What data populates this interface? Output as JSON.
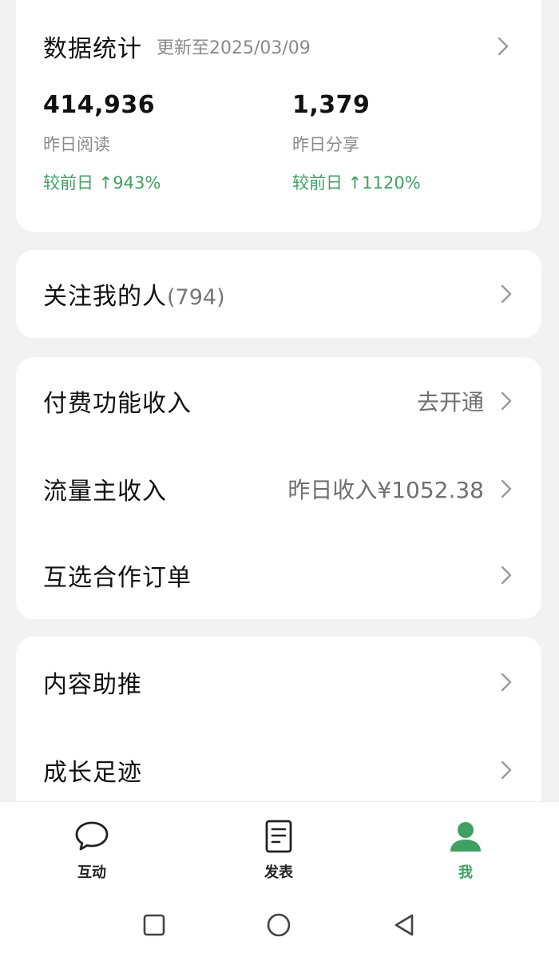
{
  "stats": {
    "title": "数据统计",
    "updated": "更新至2025/03/09",
    "reads": {
      "value": "414,936",
      "label": "昨日阅读",
      "change": "较前日 ↑943%"
    },
    "shares": {
      "value": "1,379",
      "label": "昨日分享",
      "change": "较前日 ↑1120%"
    }
  },
  "followers": {
    "label": "关注我的人",
    "count": "(794)"
  },
  "income": {
    "paid_features": {
      "label": "付费功能收入",
      "value": "去开通"
    },
    "traffic_owner": {
      "label": "流量主收入",
      "value": "昨日收入¥1052.38"
    },
    "mutual_orders": {
      "label": "互选合作订单"
    }
  },
  "tools": {
    "content_boost": {
      "label": "内容助推"
    },
    "growth_track": {
      "label": "成长足迹"
    }
  },
  "bottom_nav": {
    "items": [
      {
        "label": "互动",
        "icon": "chat-bubble-icon",
        "active": false
      },
      {
        "label": "发表",
        "icon": "document-icon",
        "active": false
      },
      {
        "label": "我",
        "icon": "user-icon",
        "active": true
      }
    ]
  },
  "colors": {
    "accent_green": "#3fa061",
    "background": "#f2f2f2",
    "card": "#ffffff",
    "secondary_text": "#8a8a8a"
  }
}
